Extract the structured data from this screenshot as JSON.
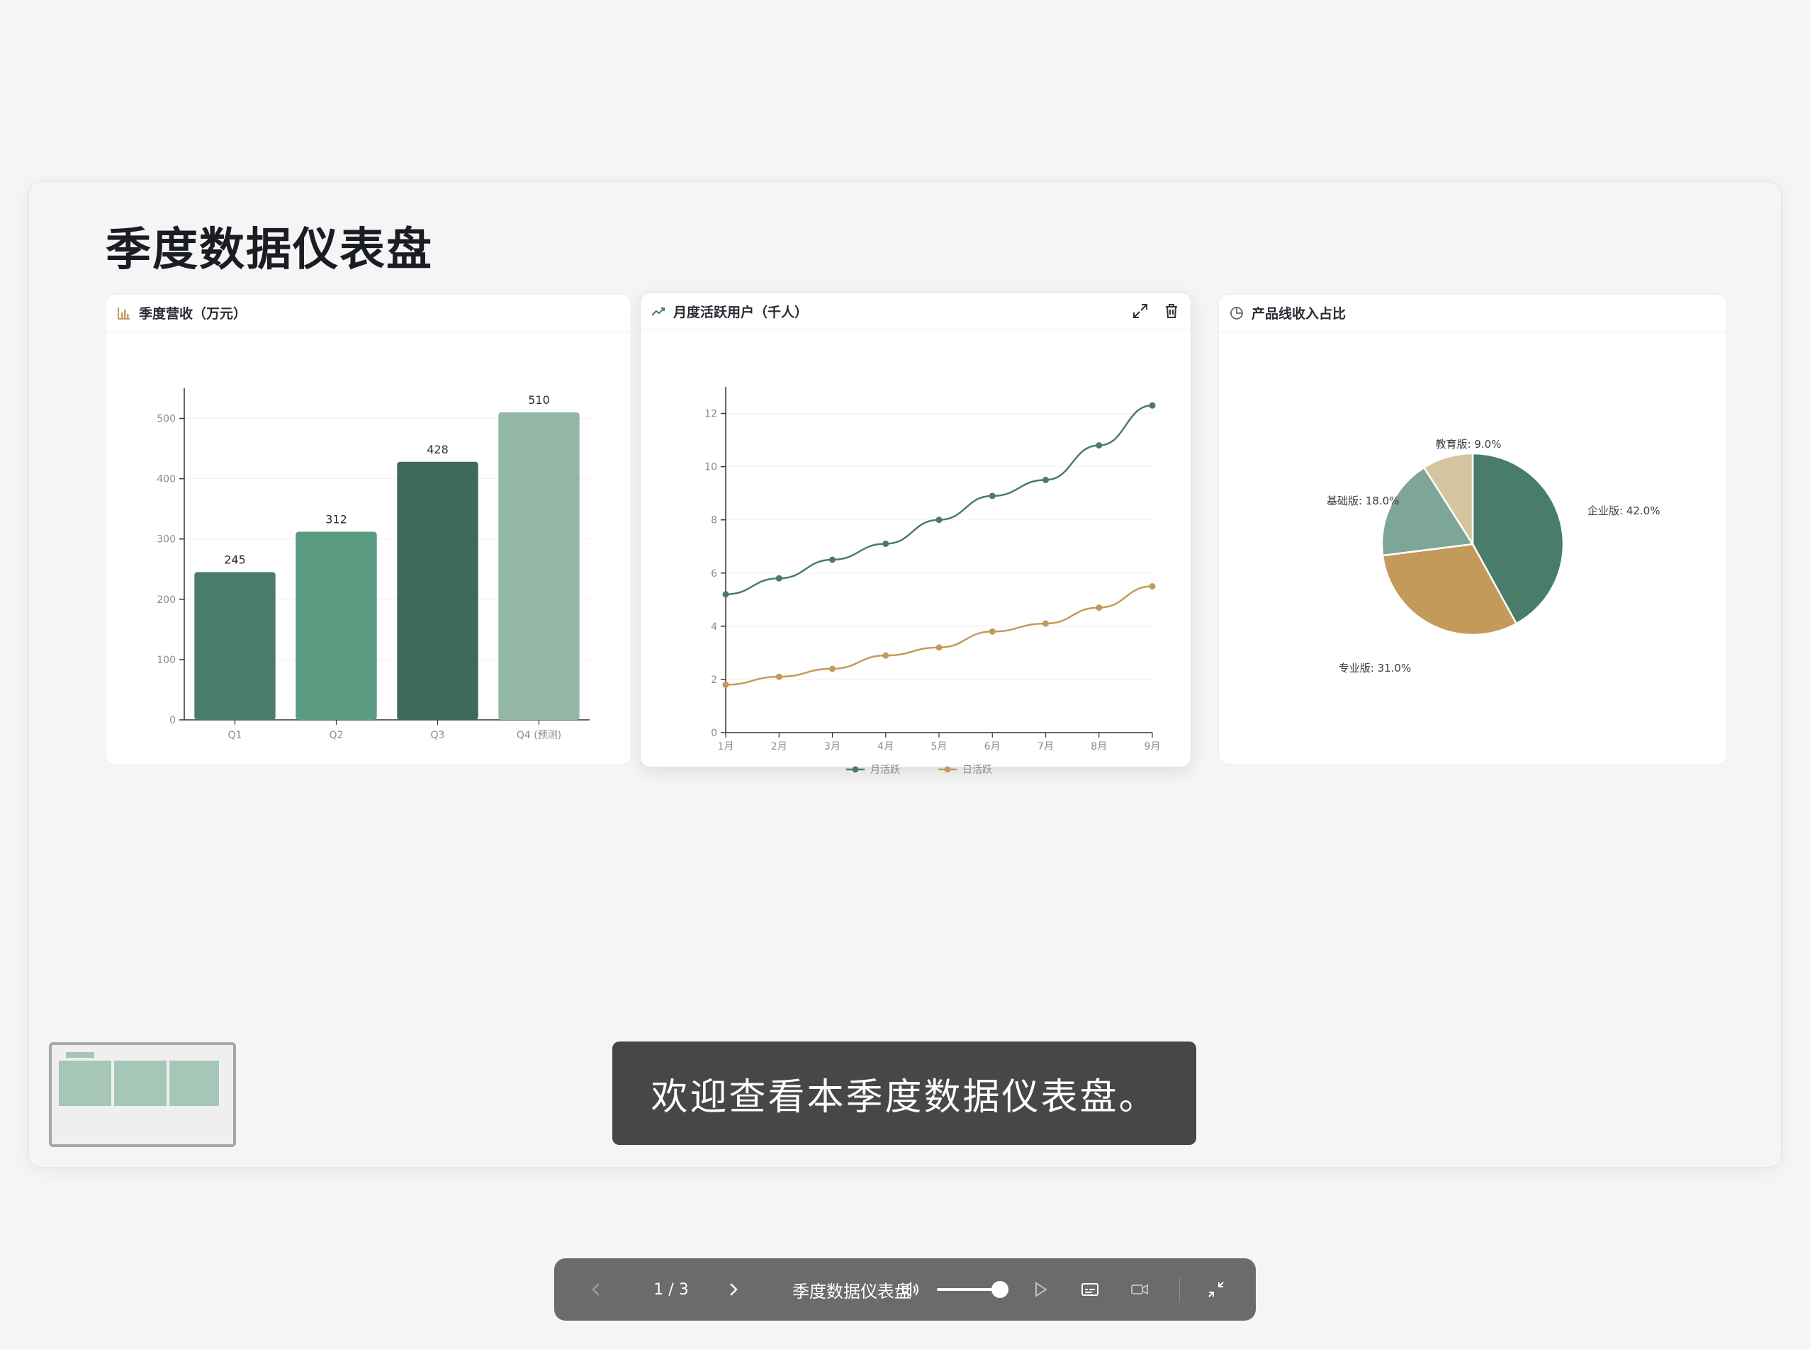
{
  "slide": {
    "title": "季度数据仪表盘"
  },
  "cards": {
    "revenue": {
      "title": "季度营收（万元）"
    },
    "users": {
      "title": "月度活跃用户（千人）"
    },
    "share": {
      "title": "产品线收入占比"
    }
  },
  "chart_data": [
    {
      "type": "bar",
      "title": "季度营收（万元）",
      "categories": [
        "Q1",
        "Q2",
        "Q3",
        "Q4 (预测)"
      ],
      "values": [
        245,
        312,
        428,
        510
      ],
      "data_labels": [
        "245",
        "312",
        "428",
        "510"
      ],
      "ylim": [
        0,
        550
      ],
      "yticks": [
        0,
        100,
        200,
        300,
        400,
        500
      ],
      "colors": [
        "#4a7c6a",
        "#5b9b82",
        "#3f6a5b",
        "#94b8a7"
      ],
      "grid": true
    },
    {
      "type": "line",
      "title": "月度活跃用户（千人）",
      "x": [
        "1月",
        "2月",
        "3月",
        "4月",
        "5月",
        "6月",
        "7月",
        "8月",
        "9月"
      ],
      "series": [
        {
          "name": "月活跃",
          "values": [
            5.2,
            5.8,
            6.5,
            7.1,
            8.0,
            8.9,
            9.5,
            10.8,
            12.3
          ],
          "color": "#4a7c6a"
        },
        {
          "name": "日活跃",
          "values": [
            1.8,
            2.1,
            2.4,
            2.9,
            3.2,
            3.8,
            4.1,
            4.7,
            5.5
          ],
          "color": "#c49a5a"
        }
      ],
      "ylim": [
        0,
        13
      ],
      "yticks": [
        0,
        2,
        4,
        6,
        8,
        10,
        12
      ],
      "legend": "bottom",
      "grid": true
    },
    {
      "type": "pie",
      "title": "产品线收入占比",
      "slices": [
        {
          "label": "企业版: 42.0%",
          "value": 42.0,
          "color": "#4a7c6a"
        },
        {
          "label": "专业版: 31.0%",
          "value": 31.0,
          "color": "#c49a5a"
        },
        {
          "label": "基础版: 18.0%",
          "value": 18.0,
          "color": "#7ea698"
        },
        {
          "label": "教育版: 9.0%",
          "value": 9.0,
          "color": "#d4c4a0"
        }
      ]
    }
  ],
  "subtitle": {
    "text": "欢迎查看本季度数据仪表盘。"
  },
  "controls": {
    "page_indicator": "1 / 3",
    "presentation_title": "季度数据仪表盘",
    "volume": 0.85
  },
  "icons": {
    "bar_chart": "bar-chart-icon",
    "line_chart": "trend-icon",
    "pie_chart": "pie-chart-icon",
    "expand": "expand-icon",
    "delete": "trash-icon"
  }
}
